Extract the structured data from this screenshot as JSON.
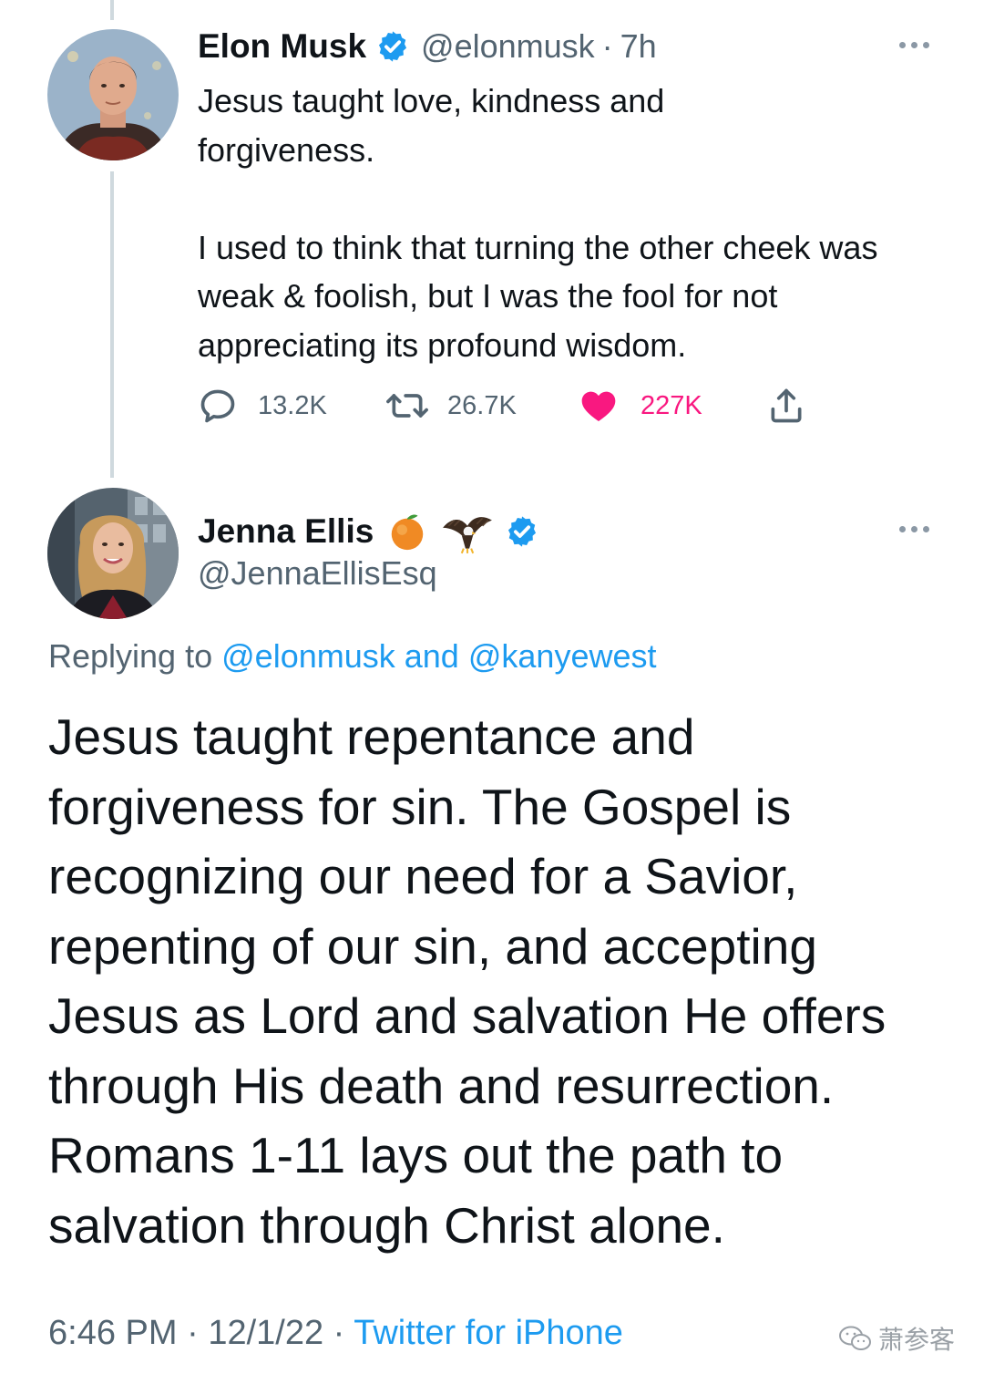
{
  "tweet1": {
    "author_name": "Elon Musk",
    "handle": "@elonmusk",
    "separator": "·",
    "time": "7h",
    "text": "Jesus taught love, kindness and\nforgiveness.\n\nI used to think that turning the other cheek was weak & foolish, but I was the fool for not appreciating its profound wisdom.",
    "stats": {
      "replies": "13.2K",
      "retweets": "26.7K",
      "likes": "227K"
    },
    "icons": [
      "reply-icon",
      "retweet-icon",
      "heart-icon",
      "share-icon",
      "verified-badge-icon",
      "more-options-icon"
    ]
  },
  "tweet2": {
    "author_name": "Jenna Ellis",
    "name_emojis": [
      "peach-emoji",
      "eagle-emoji"
    ],
    "handle": "@JennaEllisEsq",
    "replying_prefix": "Replying to",
    "replying_user1": "@elonmusk",
    "replying_and": "and",
    "replying_user2": "@kanyewest",
    "text": "Jesus taught repentance and forgiveness for sin. The Gospel is recognizing our need for a Savior, repenting of our sin, and accepting Jesus as Lord and salvation He offers through His death and resurrection. Romans 1-11 lays out the path to salvation through Christ alone.",
    "time": "6:46 PM",
    "separator": "·",
    "date": "12/1/22",
    "source": "Twitter for iPhone"
  },
  "watermark": {
    "text": "萧参客"
  },
  "colors": {
    "accent": "#1d9bf0",
    "like": "#f91880",
    "secondary_text": "#536471",
    "primary_text": "#0f1419",
    "thread_line": "#cfd9de"
  }
}
